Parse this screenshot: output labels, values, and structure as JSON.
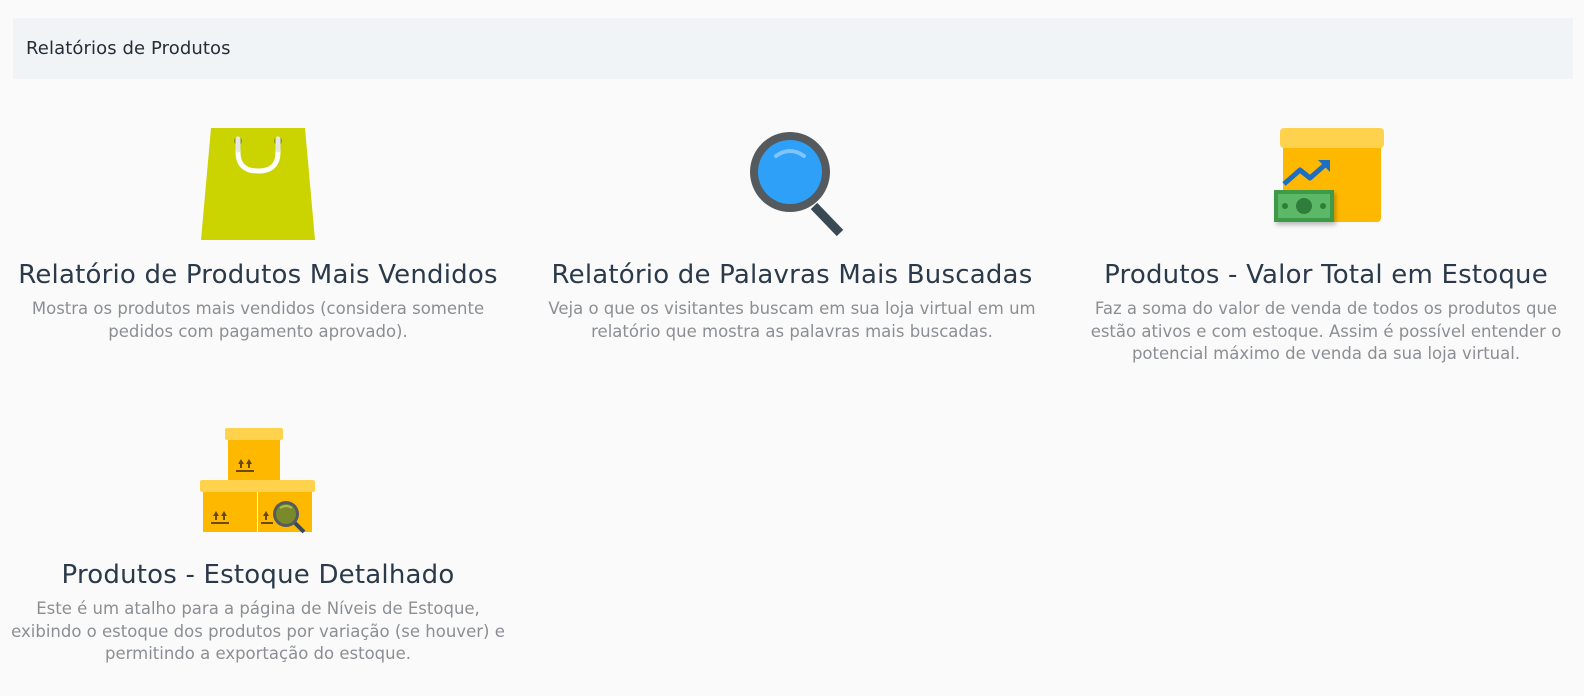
{
  "header": {
    "title": "Relatórios de Produtos"
  },
  "reports": [
    {
      "icon": "shopping-bag-icon",
      "title": "Relatório de Produtos Mais Vendidos",
      "description": "Mostra os produtos mais vendidos (considera somente pedidos com pagamento aprovado)."
    },
    {
      "icon": "magnifying-glass-icon",
      "title": "Relatório de Palavras Mais Buscadas",
      "description": "Veja o que os visitantes buscam em sua loja virtual em um relatório que mostra as palavras mais buscadas."
    },
    {
      "icon": "box-money-chart-icon",
      "title": "Produtos - Valor Total em Estoque",
      "description": "Faz a soma do valor de venda de todos os produtos que estão ativos e com estoque. Assim é possível entender o potencial máximo de venda da sua loja virtual."
    },
    {
      "icon": "boxes-search-icon",
      "title": "Produtos - Estoque Detalhado",
      "description": "Este é um atalho para a página de Níveis de Estoque, exibindo o estoque dos produtos por variação (se houver) e permitindo a exportação do estoque."
    }
  ],
  "colors": {
    "bag": "#cbd300",
    "magnifier_lens": "#2fa0f7",
    "magnifier_frame": "#555a5e",
    "box": "#ffb800",
    "money": "#3c9a48",
    "arrow": "#1d6fc4"
  }
}
